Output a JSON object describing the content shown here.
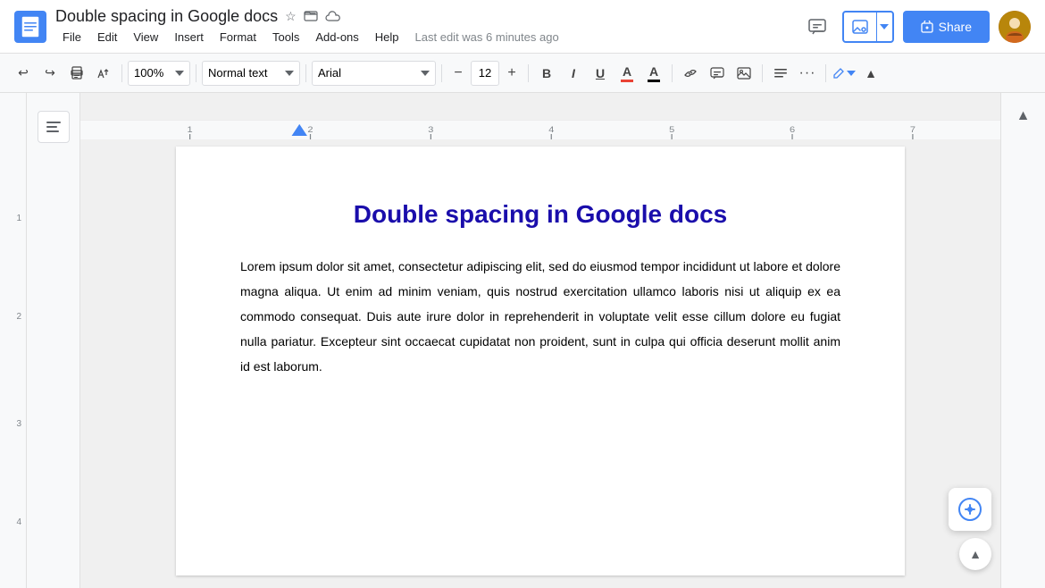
{
  "titleBar": {
    "docTitle": "Double spacing in Google docs",
    "docIcon": "📄",
    "starIcon": "☆",
    "folderIcon": "⊡",
    "cloudIcon": "☁",
    "lastEdit": "Last edit was 6 minutes ago",
    "menuItems": [
      "File",
      "Edit",
      "View",
      "Insert",
      "Format",
      "Tools",
      "Add-ons",
      "Help"
    ],
    "shareBtn": "Share",
    "lockIcon": "🔒"
  },
  "toolbar": {
    "undoLabel": "↩",
    "redoLabel": "↪",
    "printLabel": "🖨",
    "paintLabel": "⌁",
    "zoomValue": "100%",
    "styleValue": "Normal text",
    "fontValue": "Arial",
    "fontSizeValue": "12",
    "boldLabel": "B",
    "italicLabel": "I",
    "underlineLabel": "U",
    "textColorLabel": "A",
    "highlightLabel": "A",
    "linkLabel": "🔗",
    "commentLabel": "💬",
    "imageLabel": "🖼",
    "alignLabel": "≡",
    "moreLabel": "···",
    "editModeLabel": "✏"
  },
  "document": {
    "title": "Double spacing in Google docs",
    "body": "Lorem ipsum dolor sit amet, consectetur adipiscing elit, sed do eiusmod tempor incididunt ut labore et dolore magna aliqua. Ut enim ad minim veniam, quis nostrud exercitation ullamco laboris nisi ut aliquip ex ea commodo consequat. Duis aute irure dolor in reprehenderit in voluptate velit esse cillum dolore eu fugiat nulla pariatur. Excepteur sint occaecat cupidatat non proident, sunt in culpa qui officia deserunt mollit anim id est laborum."
  },
  "ruler": {
    "numbers": [
      "1",
      "2",
      "3",
      "4",
      "5",
      "6",
      "7"
    ],
    "leftNumbers": [
      "1",
      "2",
      "3"
    ]
  },
  "rightPanel": {
    "collapseIcon": "▲"
  },
  "colors": {
    "blue": "#4285f4",
    "titleBlue": "#1a0dab",
    "textColor": "#ea4335",
    "brand": "#4285f4"
  }
}
